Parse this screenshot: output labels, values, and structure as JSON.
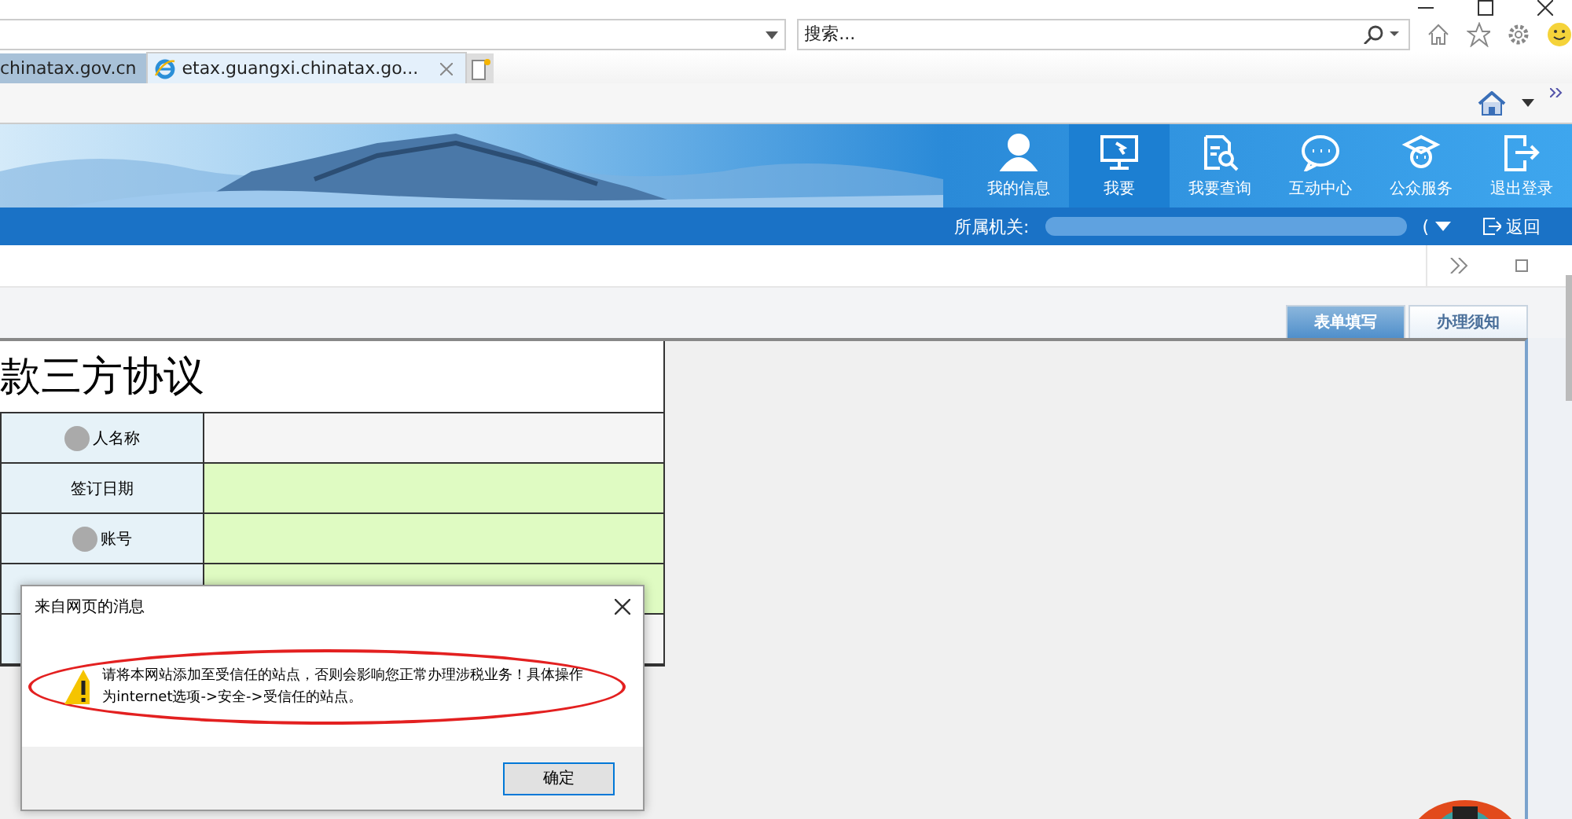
{
  "browser": {
    "search": {
      "placeholder": "搜索..."
    },
    "tabs": [
      {
        "label": "chinatax.gov.cn",
        "selected": false
      },
      {
        "label": "etax.guangxi.chinatax.go...",
        "selected": true
      }
    ]
  },
  "nav": [
    {
      "label": "我的信息",
      "selected": false
    },
    {
      "label": "我要",
      "selected": true
    },
    {
      "label": "我要查询",
      "selected": false
    },
    {
      "label": "互动中心",
      "selected": false
    },
    {
      "label": "公众服务",
      "selected": false
    },
    {
      "label": "退出登录",
      "selected": false
    }
  ],
  "office_bar": {
    "label": "所属机关:",
    "suffix": "(",
    "back": "返回"
  },
  "form_tabs": [
    {
      "label": "表单填写",
      "selected": true
    },
    {
      "label": "办理须知",
      "selected": false
    }
  ],
  "form": {
    "title": "款三方协议",
    "rows": [
      {
        "label": "人名称",
        "editable": false,
        "blurred": true
      },
      {
        "label": "签订日期",
        "editable": true,
        "blurred": false
      },
      {
        "label": "账号",
        "editable": true,
        "blurred": true
      },
      {
        "editable": true
      }
    ]
  },
  "dialog": {
    "title": "来自网页的消息",
    "message": "请将本网站添加至受信任的站点，否则会影响您正常办理涉税业务！具体操作为internet选项->安全->受信任的站点。",
    "highlighted": true,
    "button": "确定"
  }
}
